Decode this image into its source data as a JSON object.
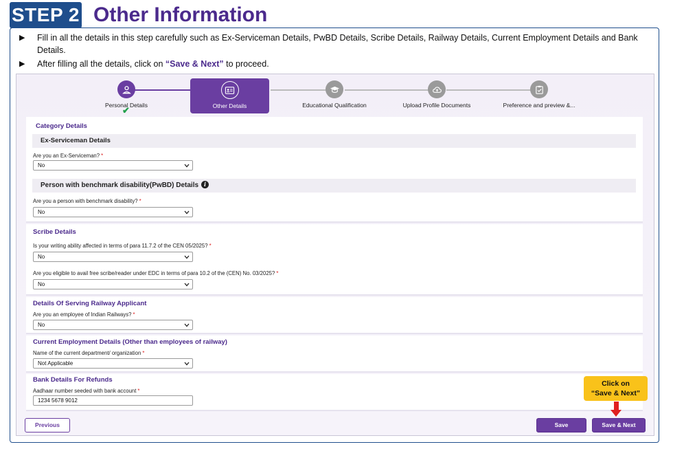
{
  "header": {
    "step_badge": "STEP 2",
    "title": "Other Information"
  },
  "instructions": [
    {
      "pre": "Fill in all the details in this step carefully such as Ex-Serviceman Details, PwBD Details, Scribe Details, Railway Details, Current Employment Details and Bank Details.",
      "highlight": "",
      "post": ""
    },
    {
      "pre": "After filling all the details, click on ",
      "highlight": "“Save & Next”",
      "post": " to proceed."
    }
  ],
  "stepper": {
    "steps": [
      {
        "label": "Personal Details",
        "icon": "person-icon",
        "state": "done"
      },
      {
        "label": "Other Details",
        "icon": "id-card-icon",
        "state": "active"
      },
      {
        "label": "Educational Qualification",
        "icon": "graduation-cap-icon",
        "state": "pending"
      },
      {
        "label": "Upload Profile Documents",
        "icon": "cloud-upload-icon",
        "state": "pending"
      },
      {
        "label": "Preference and preview &...",
        "icon": "clipboard-icon",
        "state": "pending"
      }
    ]
  },
  "category": {
    "title": "Category Details",
    "ex_serviceman": {
      "heading": "Ex-Serviceman Details",
      "question": "Are you an Ex-Serviceman?",
      "value": "No"
    },
    "pwbd": {
      "heading": "Person with benchmark disability(PwBD) Details",
      "info_icon_glyph": "i",
      "question": "Are you a person with benchmark disability?",
      "value": "No"
    }
  },
  "scribe": {
    "title": "Scribe Details",
    "q1": "Is your writing ability affected in terms of para 11.7.2 of the CEN 05/2025?",
    "q1_value": "No",
    "q2": "Are you eligible to avail free scribe/reader under EDC in terms of para 10.2 of the (CEN) No. 03/2025?",
    "q2_value": "No"
  },
  "railway": {
    "title": "Details Of Serving Railway Applicant",
    "question": "Are you an employee of Indian Railways?",
    "value": "No"
  },
  "employment": {
    "title": "Current Employment Details (Other than employees of railway)",
    "question": "Name of the current department/ organization",
    "value": "Not Applicable"
  },
  "bank": {
    "title": "Bank Details For Refunds",
    "question": "Aadhaar number seeded with bank account",
    "value": "1234 5678 9012"
  },
  "required_marker": "*",
  "buttons": {
    "previous": "Previous",
    "save": "Save",
    "save_next": "Save & Next"
  },
  "callout": {
    "line1": "Click on",
    "line2": "“Save & Next”"
  },
  "colors": {
    "brand_purple": "#6a3ea1",
    "step_badge_blue": "#1f4e8c",
    "callout_yellow": "#f9c21a",
    "arrow_red": "#e02020",
    "done_check_green": "#22a04b"
  }
}
